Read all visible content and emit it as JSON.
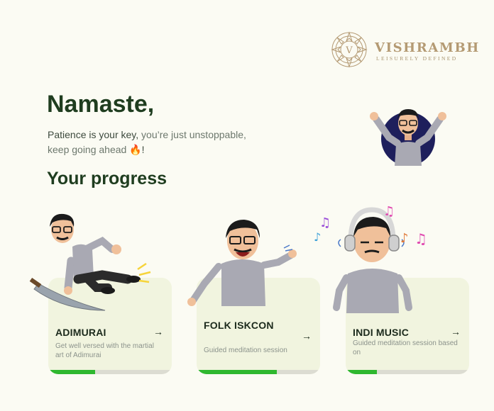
{
  "brand": {
    "initial": "V",
    "name": "VISHRAMBH",
    "tagline": "LEISURELY DEFINED"
  },
  "greeting": "Namaste,",
  "motto": {
    "main": "Patience is your key,",
    "soft": " you’re just unstoppable, keep going ahead",
    "emoji": "🔥",
    "end": "!"
  },
  "section_title": "Your progress",
  "cards": [
    {
      "title": "ADIMURAI",
      "description": "Get well versed with the martial art of Adimurai",
      "progress": 0.38,
      "arrow": "→"
    },
    {
      "title": "FOLK ISKCON",
      "description": "Guided meditation session",
      "progress": 0.65,
      "arrow": "→"
    },
    {
      "title": "INDI MUSIC",
      "description": "Guided meditation session based on",
      "progress": 0.25,
      "arrow": "→"
    }
  ],
  "colors": {
    "accent": "#2fb82f",
    "heading": "#1f3d1f",
    "card": "#f1f4df",
    "brand": "#b49a73",
    "avatar_bg": "#1e1f5c"
  }
}
